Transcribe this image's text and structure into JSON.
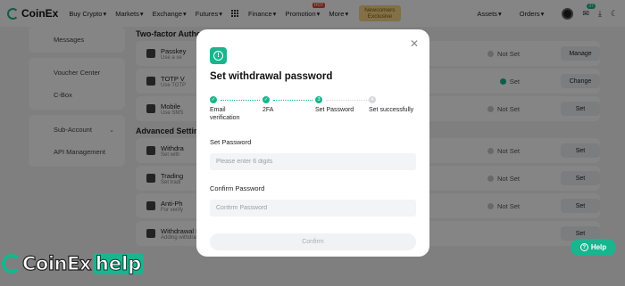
{
  "topbar": {
    "logo": "CoinEx",
    "nav": [
      "Buy Crypto",
      "Markets",
      "Exchange",
      "Futures",
      "Finance",
      "Promotion",
      "More"
    ],
    "hot_badge": "HOT",
    "newcomer": {
      "line1": "Newcomers",
      "line2": "Exclusive"
    },
    "right": {
      "assets": "Assets",
      "orders": "Orders",
      "notification_count": "37"
    }
  },
  "sidebar": {
    "items": [
      "Messages",
      "Voucher Center",
      "C-Box",
      "Sub-Account",
      "API Management"
    ]
  },
  "main": {
    "section1_title": "Two-factor Authe",
    "section2_title": "Advanced Setting",
    "rows": [
      {
        "name": "Passkey",
        "desc": "Use a se",
        "status": "Not Set",
        "button": "Manage",
        "enabled": false
      },
      {
        "name": "TOTP V",
        "desc": "Use TOTP",
        "status": "Set",
        "button": "Change",
        "enabled": true
      },
      {
        "name": "Mobile",
        "desc": "Use SMS",
        "status": "Not Set",
        "button": "Set",
        "enabled": false
      },
      {
        "name": "Withdra",
        "desc": "Set with",
        "status": "Not Set",
        "button": "Set",
        "enabled": false
      },
      {
        "name": "Trading",
        "desc": "Set tradi",
        "status": "Not Set",
        "button": "Set",
        "enabled": false
      },
      {
        "name": "Anti-Ph",
        "desc": "For verify",
        "status": "Not Set",
        "button": "Set",
        "enabled": false
      },
      {
        "name": "Withdrawal Multi-Approval",
        "desc": "Adding withdrawal approval Email to co-manage the account",
        "status": "",
        "button": "Set",
        "enabled": false
      }
    ]
  },
  "modal": {
    "title": "Set withdrawal password",
    "steps": [
      {
        "label": "Email verification",
        "marker": "✓",
        "done": true
      },
      {
        "label": "2FA",
        "marker": "✓",
        "done": true
      },
      {
        "label": "Set Password",
        "marker": "3",
        "done": true
      },
      {
        "label": "Set successfully",
        "marker": "4",
        "done": false
      }
    ],
    "set_password_label": "Set Password",
    "set_password_placeholder": "Please enter 6 digits",
    "confirm_password_label": "Confirm Password",
    "confirm_password_placeholder": "Confirm Password",
    "confirm_button": "Confirm"
  },
  "help_button": "Help",
  "watermark": {
    "brand": "CoinEx",
    "suffix": "help"
  },
  "colors": {
    "accent": "#18b58e",
    "overlay": "rgba(0,0,0,0.48)"
  }
}
